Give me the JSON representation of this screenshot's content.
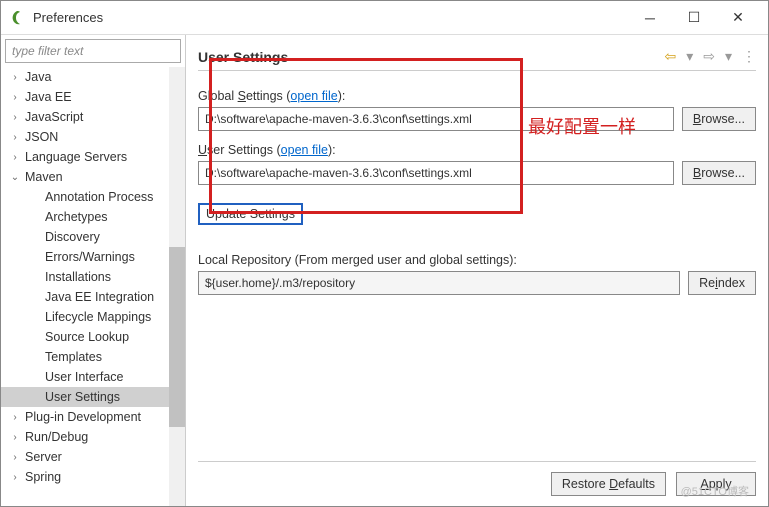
{
  "window": {
    "title": "Preferences"
  },
  "sidebar": {
    "filter_placeholder": "type filter text",
    "items": [
      {
        "label": "Java",
        "expandable": true,
        "expanded": false,
        "indent": 0
      },
      {
        "label": "Java EE",
        "expandable": true,
        "expanded": false,
        "indent": 0
      },
      {
        "label": "JavaScript",
        "expandable": true,
        "expanded": false,
        "indent": 0
      },
      {
        "label": "JSON",
        "expandable": true,
        "expanded": false,
        "indent": 0
      },
      {
        "label": "Language Servers",
        "expandable": true,
        "expanded": false,
        "indent": 0
      },
      {
        "label": "Maven",
        "expandable": true,
        "expanded": true,
        "indent": 0
      },
      {
        "label": "Annotation Process",
        "expandable": false,
        "indent": 1
      },
      {
        "label": "Archetypes",
        "expandable": false,
        "indent": 1
      },
      {
        "label": "Discovery",
        "expandable": false,
        "indent": 1
      },
      {
        "label": "Errors/Warnings",
        "expandable": false,
        "indent": 1
      },
      {
        "label": "Installations",
        "expandable": false,
        "indent": 1
      },
      {
        "label": "Java EE Integration",
        "expandable": false,
        "indent": 1
      },
      {
        "label": "Lifecycle Mappings",
        "expandable": false,
        "indent": 1
      },
      {
        "label": "Source Lookup",
        "expandable": false,
        "indent": 1
      },
      {
        "label": "Templates",
        "expandable": false,
        "indent": 1
      },
      {
        "label": "User Interface",
        "expandable": false,
        "indent": 1
      },
      {
        "label": "User Settings",
        "expandable": false,
        "indent": 1,
        "selected": true
      },
      {
        "label": "Plug-in Development",
        "expandable": true,
        "expanded": false,
        "indent": 0
      },
      {
        "label": "Run/Debug",
        "expandable": true,
        "expanded": false,
        "indent": 0
      },
      {
        "label": "Server",
        "expandable": true,
        "expanded": false,
        "indent": 0
      },
      {
        "label": "Spring",
        "expandable": true,
        "expanded": false,
        "indent": 0
      }
    ]
  },
  "main": {
    "title": "User Settings",
    "global_label_prefix": "Global ",
    "global_label_u": "S",
    "global_label_suffix": "ettings (",
    "open_file": "open file",
    "label_close": "):",
    "global_value": "D:\\software\\apache-maven-3.6.3\\conf\\settings.xml",
    "user_label_prefix": "",
    "user_label_u": "U",
    "user_label_suffix": "ser Settings (",
    "user_value": "D:\\software\\apache-maven-3.6.3\\conf\\settings.xml",
    "browse_label": "Browse...",
    "browse_u": "B",
    "update_label": "Update Settings",
    "local_repo_label": "Local Repository (From merged user and global settings):",
    "local_repo_value": "${user.home}/.m3/repository",
    "reindex_label_pre": "Re",
    "reindex_u": "i",
    "reindex_label_post": "ndex"
  },
  "footer": {
    "restore": "Restore Defaults",
    "restore_u": "D",
    "apply": "Apply",
    "apply_u": "A"
  },
  "annotation": "最好配置一样",
  "watermark": "@51CTO博客"
}
